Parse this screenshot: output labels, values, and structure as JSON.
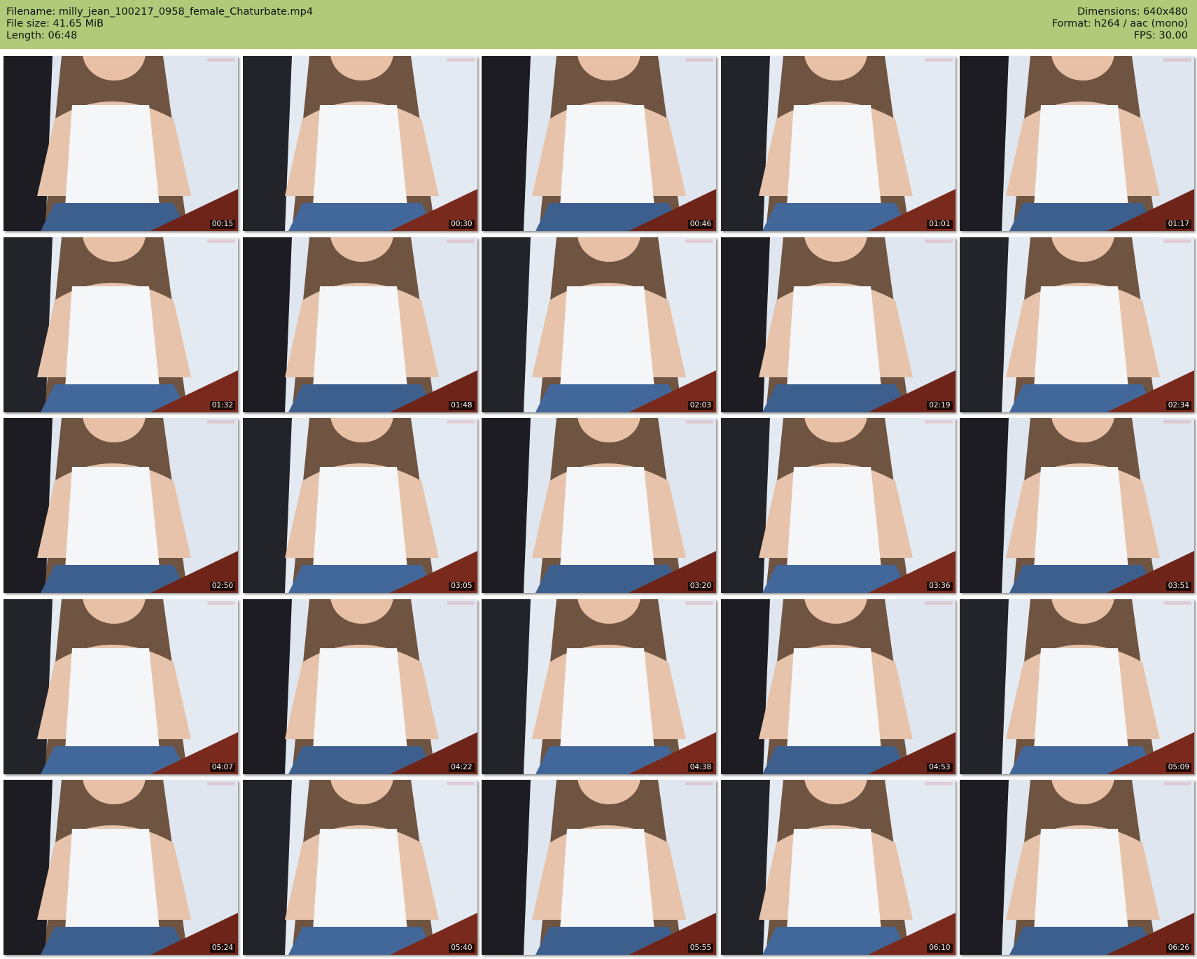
{
  "header": {
    "filename": "Filename: milly_jean_100217_0958_female_Chaturbate.mp4",
    "filesize": "File size: 41.65 MiB",
    "length": "Length: 06:48",
    "dimensions": "Dimensions: 640x480",
    "format": "Format: h264 / aac (mono)",
    "fps": "FPS: 30.00"
  },
  "colors": {
    "header_bg": "#b0ca7a",
    "page_bg": "#ffffff",
    "timestamp_bg": "#000000",
    "timestamp_text": "#f2f2f2"
  },
  "thumbnails": [
    {
      "time": "00:15"
    },
    {
      "time": "00:30"
    },
    {
      "time": "00:46"
    },
    {
      "time": "01:01"
    },
    {
      "time": "01:17"
    },
    {
      "time": "01:32"
    },
    {
      "time": "01:48"
    },
    {
      "time": "02:03"
    },
    {
      "time": "02:19"
    },
    {
      "time": "02:34"
    },
    {
      "time": "02:50"
    },
    {
      "time": "03:05"
    },
    {
      "time": "03:20"
    },
    {
      "time": "03:36"
    },
    {
      "time": "03:51"
    },
    {
      "time": "04:07"
    },
    {
      "time": "04:22"
    },
    {
      "time": "04:38"
    },
    {
      "time": "04:53"
    },
    {
      "time": "05:09"
    },
    {
      "time": "05:24"
    },
    {
      "time": "05:40"
    },
    {
      "time": "05:55"
    },
    {
      "time": "06:10"
    },
    {
      "time": "06:26"
    }
  ]
}
